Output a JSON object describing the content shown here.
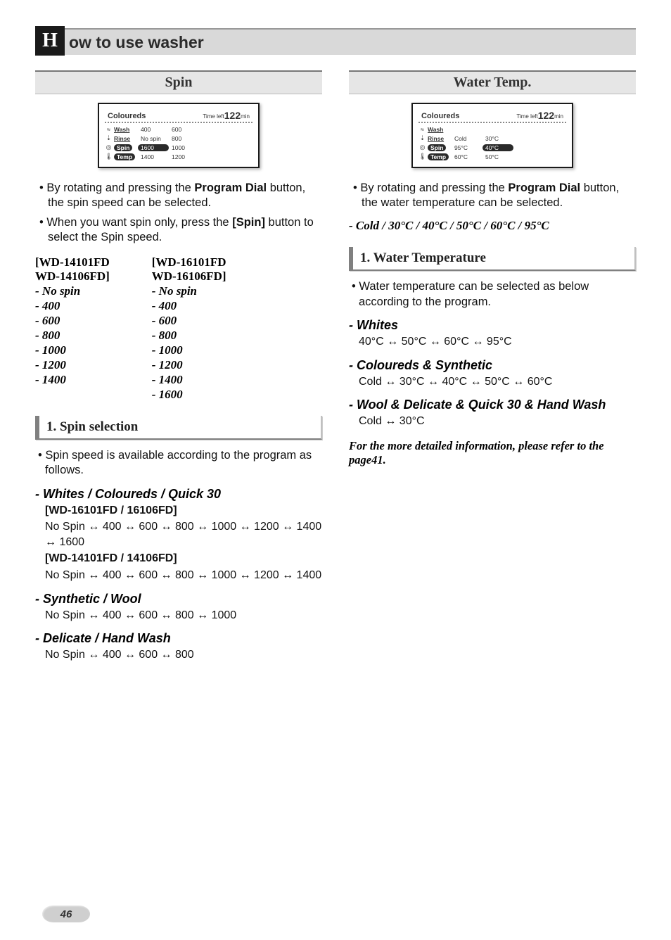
{
  "header": {
    "initial": "H",
    "title": "ow to use washer"
  },
  "page_number": "46",
  "left": {
    "section_title": "Spin",
    "lcd": {
      "program": "Coloureds",
      "time_label": "Time left",
      "time_value": "122",
      "time_unit": "min",
      "rows": [
        {
          "icon": "≈",
          "label": "Wash",
          "label_pill": false,
          "vals": [
            {
              "text": "400",
              "pill": false
            },
            {
              "text": "600",
              "pill": false
            }
          ]
        },
        {
          "icon": "⇣",
          "label": "Rinse",
          "label_pill": false,
          "vals": [
            {
              "text": "No spin",
              "pill": false
            },
            {
              "text": "800",
              "pill": false
            }
          ]
        },
        {
          "icon": "◎",
          "label": "Spin",
          "label_pill": true,
          "vals": [
            {
              "text": "1600",
              "pill": true
            },
            {
              "text": "1000",
              "pill": false
            }
          ]
        },
        {
          "icon": "🌡",
          "label": "Temp",
          "label_pill": true,
          "vals": [
            {
              "text": "1400",
              "pill": false
            },
            {
              "text": "1200",
              "pill": false
            }
          ]
        }
      ]
    },
    "bullets": [
      {
        "pre": "By rotating and pressing the ",
        "bold1": "Program Dial",
        "mid": " button, the spin speed can be selected."
      },
      {
        "pre": "When you want spin only, press the ",
        "bold1": "[Spin]",
        "mid": " button to select the Spin speed."
      }
    ],
    "spin_cols": [
      {
        "model1": "[WD-14101FD",
        "model2": "WD-14106FD]",
        "opts": [
          "- No spin",
          "- 400",
          "- 600",
          "- 800",
          "- 1000",
          "- 1200",
          "- 1400"
        ]
      },
      {
        "model1": "[WD-16101FD",
        "model2": "WD-16106FD]",
        "opts": [
          "- No spin",
          "- 400",
          "- 600",
          "- 800",
          "- 1000",
          "- 1200",
          "- 1400",
          "- 1600"
        ]
      }
    ],
    "sub_heading": "1. Spin selection",
    "sub_bullet": "Spin speed is available according to the program as follows.",
    "progs": [
      {
        "head": "- Whites / Coloureds / Quick 30",
        "lines": [
          {
            "bold": "[WD-16101FD / 16106FD]"
          },
          {
            "text": "No Spin ↔ 400 ↔ 600 ↔ 800 ↔ 1000 ↔ 1200 ↔ 1400 ↔ 1600"
          },
          {
            "bold": "[WD-14101FD / 14106FD]"
          },
          {
            "text": "No Spin ↔ 400 ↔ 600 ↔ 800 ↔ 1000 ↔ 1200 ↔ 1400"
          }
        ]
      },
      {
        "head": "- Synthetic / Wool",
        "lines": [
          {
            "text": "No Spin ↔ 400 ↔ 600 ↔ 800 ↔ 1000"
          }
        ]
      },
      {
        "head": "- Delicate / Hand Wash",
        "lines": [
          {
            "text": "No Spin ↔ 400 ↔ 600 ↔ 800"
          }
        ]
      }
    ]
  },
  "right": {
    "section_title": "Water Temp.",
    "lcd": {
      "program": "Coloureds",
      "time_label": "Time left",
      "time_value": "122",
      "time_unit": "min",
      "rows": [
        {
          "icon": "≈",
          "label": "Wash",
          "label_pill": false,
          "vals": []
        },
        {
          "icon": "⇣",
          "label": "Rinse",
          "label_pill": false,
          "vals": [
            {
              "text": "Cold",
              "pill": false
            },
            {
              "text": "30°C",
              "pill": false
            }
          ]
        },
        {
          "icon": "◎",
          "label": "Spin",
          "label_pill": true,
          "vals": [
            {
              "text": "95°C",
              "pill": false
            },
            {
              "text": "40°C",
              "pill": true
            }
          ]
        },
        {
          "icon": "🌡",
          "label": "Temp",
          "label_pill": true,
          "vals": [
            {
              "text": "60°C",
              "pill": false
            },
            {
              "text": "50°C",
              "pill": false
            }
          ]
        }
      ]
    },
    "bullets": [
      {
        "pre": "By rotating and pressing the ",
        "bold1": "Program Dial",
        "mid": " button, the water temperature can be selected."
      }
    ],
    "italic_line": "- Cold / 30°C / 40°C / 50°C / 60°C / 95°C",
    "sub_heading": "1. Water Temperature",
    "sub_bullet": "Water temperature can be selected as below according to the program.",
    "progs": [
      {
        "head": "- Whites",
        "lines": [
          {
            "text": "40°C ↔ 50°C ↔ 60°C ↔ 95°C"
          }
        ]
      },
      {
        "head": "- Coloureds & Synthetic",
        "lines": [
          {
            "text": "Cold ↔ 30°C ↔ 40°C ↔ 50°C ↔ 60°C"
          }
        ]
      },
      {
        "head": "- Wool & Delicate & Quick 30 & Hand Wash",
        "lines": [
          {
            "text": "Cold ↔ 30°C"
          }
        ]
      }
    ],
    "footer_italic": "For the more detailed information, please refer to the page41."
  }
}
